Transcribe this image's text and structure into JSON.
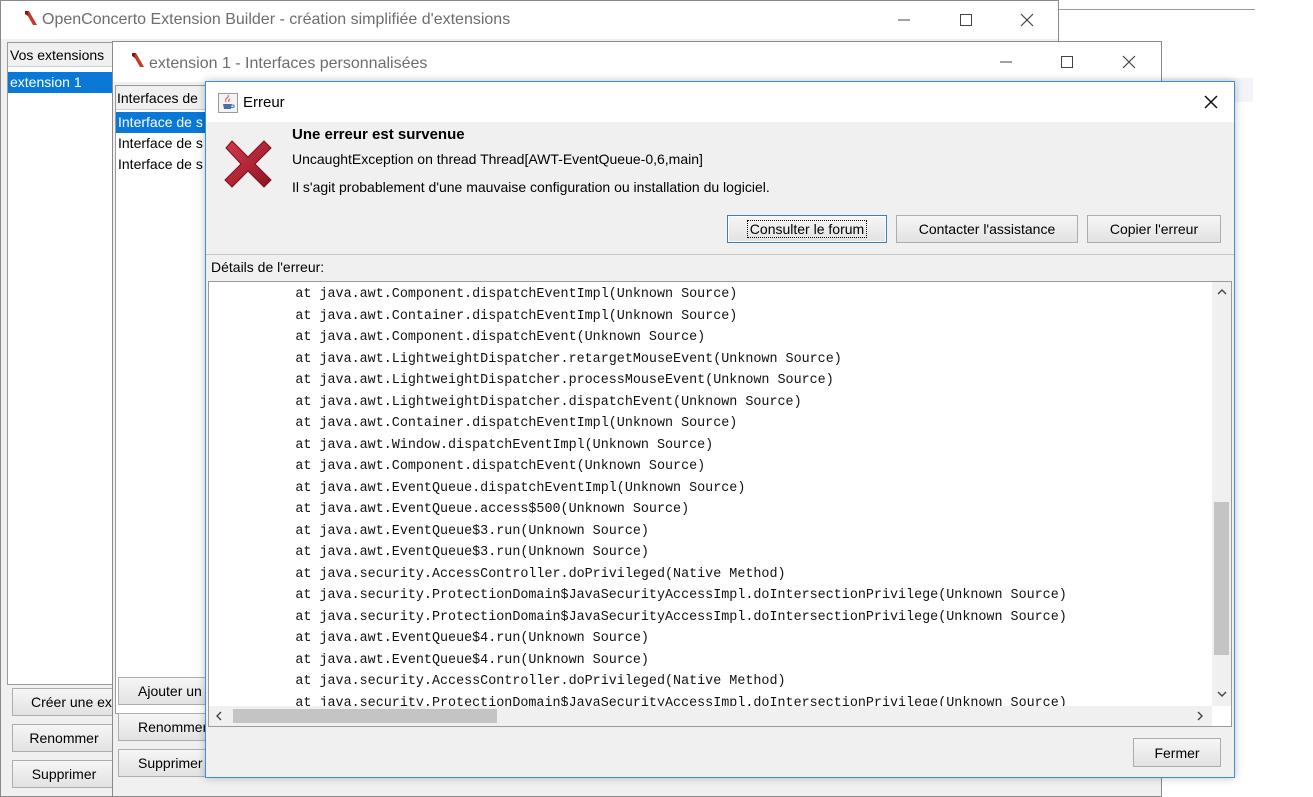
{
  "main_window": {
    "title": "OpenConcerto Extension Builder - création simplifiée d'extensions",
    "list_header": "Vos extensions",
    "extensions": [
      "extension 1"
    ],
    "buttons": {
      "create": "Créer une ex",
      "rename": "Renommer",
      "delete": "Supprimer"
    }
  },
  "ext_window": {
    "title": "extension 1 - Interfaces personnalisées",
    "list_header": "Interfaces de",
    "items": [
      "Interface de s",
      "Interface de s",
      "Interface de s"
    ],
    "buttons": {
      "add": "Ajouter un",
      "rename": "Renommer",
      "delete": "Supprimer"
    }
  },
  "error_dialog": {
    "title": "Erreur",
    "heading": "Une erreur est survenue",
    "message": "UncaughtException on thread Thread[AWT-EventQueue-0,6,main]",
    "hint": "Il s'agit probablement d'une mauvaise configuration ou installation du logiciel.",
    "buttons": {
      "forum": "Consulter le forum",
      "support": "Contacter l'assistance",
      "copy": "Copier l'erreur",
      "close": "Fermer"
    },
    "details_label": "Détails de l'erreur:",
    "stack_trace": [
      "\tat java.awt.Component.dispatchEventImpl(Unknown Source)",
      "\tat java.awt.Container.dispatchEventImpl(Unknown Source)",
      "\tat java.awt.Component.dispatchEvent(Unknown Source)",
      "\tat java.awt.LightweightDispatcher.retargetMouseEvent(Unknown Source)",
      "\tat java.awt.LightweightDispatcher.processMouseEvent(Unknown Source)",
      "\tat java.awt.LightweightDispatcher.dispatchEvent(Unknown Source)",
      "\tat java.awt.Container.dispatchEventImpl(Unknown Source)",
      "\tat java.awt.Window.dispatchEventImpl(Unknown Source)",
      "\tat java.awt.Component.dispatchEvent(Unknown Source)",
      "\tat java.awt.EventQueue.dispatchEventImpl(Unknown Source)",
      "\tat java.awt.EventQueue.access$500(Unknown Source)",
      "\tat java.awt.EventQueue$3.run(Unknown Source)",
      "\tat java.awt.EventQueue$3.run(Unknown Source)",
      "\tat java.security.AccessController.doPrivileged(Native Method)",
      "\tat java.security.ProtectionDomain$JavaSecurityAccessImpl.doIntersectionPrivilege(Unknown Source)",
      "\tat java.security.ProtectionDomain$JavaSecurityAccessImpl.doIntersectionPrivilege(Unknown Source)",
      "\tat java.awt.EventQueue$4.run(Unknown Source)",
      "\tat java.awt.EventQueue$4.run(Unknown Source)",
      "\tat java.security.AccessController.doPrivileged(Native Method)",
      "\tat java.security.ProtectionDomain$JavaSecurityAccessImpl.doIntersectionPrivilege(Unknown Source)"
    ]
  },
  "icons": {
    "minimize": "minimize-icon",
    "maximize": "maximize-icon",
    "close": "close-icon",
    "error": "error-x-icon",
    "java": "java-cup-icon",
    "app": "openconcerto-logo-icon"
  },
  "colors": {
    "selection": "#0a78d7",
    "dialog_border": "#3b8fd9",
    "error_red": "#b81c2e",
    "window_bg": "#f0f0f0"
  }
}
